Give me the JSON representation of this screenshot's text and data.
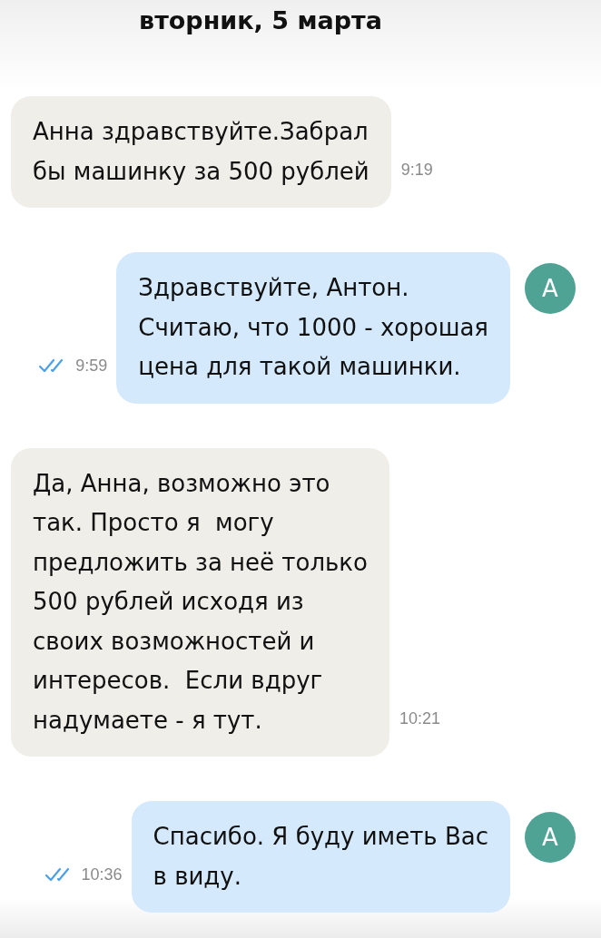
{
  "date_header": "вторник, 5 марта",
  "messages": [
    {
      "kind": "incoming",
      "text": "Анна здравствуйте.Забрал\nбы машинку за 500 рублей",
      "time": "9:19"
    },
    {
      "kind": "outgoing",
      "text": "Здравствуйте, Антон.\nСчитаю, что 1000 - хорошая\nцена для такой машинки.",
      "time": "9:59",
      "read": true,
      "avatar": "А"
    },
    {
      "kind": "incoming",
      "text": "Да, Анна, возможно это\nтак. Просто я  могу\nпредложить за неё только\n500 рублей исходя из\nсвоих возможностей и\nинтересов.  Если вдруг\nнадумаете - я тут.",
      "time": "10:21"
    },
    {
      "kind": "outgoing",
      "text": "Спасибо. Я буду иметь Вас\nв виду.",
      "time": "10:36",
      "read": true,
      "avatar": "А"
    }
  ]
}
